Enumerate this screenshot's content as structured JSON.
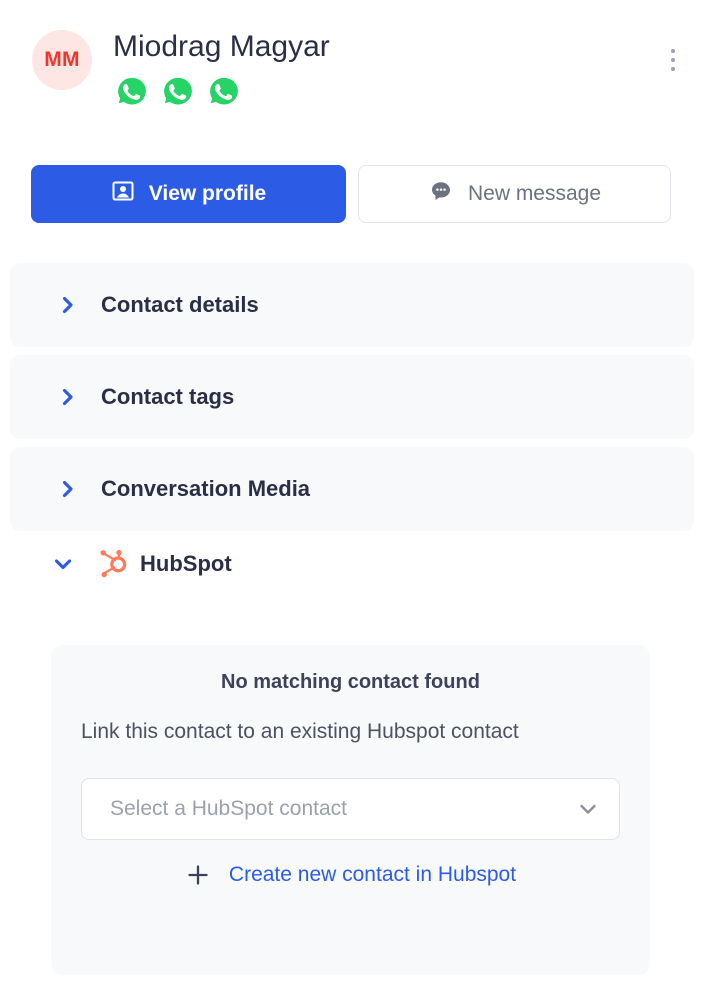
{
  "header": {
    "avatar_initials": "MM",
    "contact_name": "Miodrag Magyar",
    "avatar_bg": "#fde6e4",
    "avatar_text_color": "#f2342b",
    "menu_icon": "kebab-menu-icon",
    "channels": [
      {
        "icon": "whatsapp-icon",
        "color": "#25D366"
      },
      {
        "icon": "whatsapp-icon",
        "color": "#25D366"
      },
      {
        "icon": "whatsapp-icon",
        "color": "#25D366"
      }
    ]
  },
  "actions": {
    "view_profile": {
      "label": "View profile",
      "icon": "contact-card-icon",
      "bg": "#2c5ce6",
      "text_color": "#ffffff"
    },
    "new_message": {
      "label": "New message",
      "icon": "chat-bubble-icon",
      "bg": "#ffffff",
      "text_color": "#6b7280"
    }
  },
  "accordions": [
    {
      "label": "Contact details",
      "icon": "chevron-right-icon",
      "expanded": false
    },
    {
      "label": "Contact tags",
      "icon": "chevron-right-icon",
      "expanded": false
    },
    {
      "label": "Conversation Media",
      "icon": "chevron-right-icon",
      "expanded": false
    }
  ],
  "hubspot": {
    "title": "HubSpot",
    "icon": "hubspot-logo-icon",
    "chevron": "chevron-down-icon",
    "brand_color": "#ff7a59",
    "expanded": true,
    "card": {
      "title": "No matching contact found",
      "description": "Link this contact to an existing Hubspot contact",
      "select_placeholder": "Select a HubSpot contact",
      "select_value": "",
      "select_icon": "chevron-down-icon",
      "create_label": "Create new contact in Hubspot",
      "create_icon": "plus-icon",
      "link_color": "#2c5ce6"
    }
  },
  "theme": {
    "accent": "#2c5ce6",
    "card_bg": "#f8f9fb",
    "page_bg": "#ffffff",
    "text_primary": "#2a2f45"
  }
}
